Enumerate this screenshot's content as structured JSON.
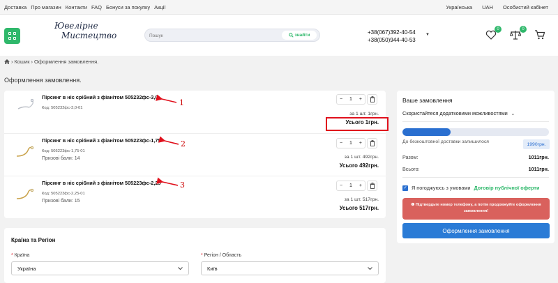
{
  "topbar": {
    "links": [
      "Доставка",
      "Про магазин",
      "Контакти",
      "FAQ",
      "Бонуси за покупку",
      "Акції"
    ],
    "language": "Українська",
    "currency": "UAH",
    "account": "Особистий кабінет"
  },
  "header": {
    "logo_line1": "Ювелірне",
    "logo_line2": "Мистецтво",
    "search_placeholder": "Пошук",
    "search_button": "знайти",
    "phone1": "+38(067)392-40-54",
    "phone2": "+38(050)944-40-53",
    "wishlist_count": "0",
    "compare_count": "0"
  },
  "breadcrumb": {
    "items": [
      "Кошик",
      "Оформлення замовлення."
    ]
  },
  "page_title": "Оформлення замовлення.",
  "cart": {
    "items": [
      {
        "name": "Пірсинг в ніс срібний з фіанітом 505232фс-3,0",
        "code": "Код: 505232фс-3,0-01",
        "bonus": "",
        "qty": "1",
        "unit_price": "за 1 шт.  1грн.",
        "total": "Усього  1грн.",
        "annotation": "1"
      },
      {
        "name": "Пірсинг в ніс срібний з фіанітом 505223фс-1,75",
        "code": "Код: 505223фс-1,75-01",
        "bonus": "Призові бали: 14",
        "qty": "1",
        "unit_price": "за 1 шт.  492грн.",
        "total": "Усього  492грн.",
        "annotation": "2"
      },
      {
        "name": "Пірсинг в ніс срібний з фіанітом 505223фс-2,25",
        "code": "Код: 505223фс-2,25-01",
        "bonus": "Призові бали: 15",
        "qty": "1",
        "unit_price": "за 1 шт.  517грн.",
        "total": "Усього  517грн.",
        "annotation": "3"
      }
    ],
    "minus": "−",
    "plus": "+"
  },
  "region": {
    "title": "Країна та Регіон",
    "country_label": "Країна",
    "country_value": "Україна",
    "region_label": "Регіон / Область",
    "region_value": "Київ"
  },
  "summary": {
    "title": "Ваше замовлення",
    "extra": "Скористайтеся додатковими можливостями",
    "progress_fraction": 0.33,
    "free_delivery_text": "До безкоштовної доставки залишилося",
    "free_delivery_value": "1990грн.",
    "subtotal_label": "Разом:",
    "subtotal_value": "1011грн.",
    "total_label": "Всього:",
    "total_value": "1011грн.",
    "agree_text": "Я погоджуюсь з умовами",
    "agree_link": "Договір публічної оферти",
    "warning": "Підтвердьте номер телефону, а потім продовжуйте оформлення замовлення!",
    "order_button": "Оформлення замовлення"
  },
  "colors": {
    "brand_green": "#2fb86b",
    "accent_blue": "#2a7bd6",
    "annotation_red": "#e0101c",
    "warning_bg": "#d9615d"
  }
}
